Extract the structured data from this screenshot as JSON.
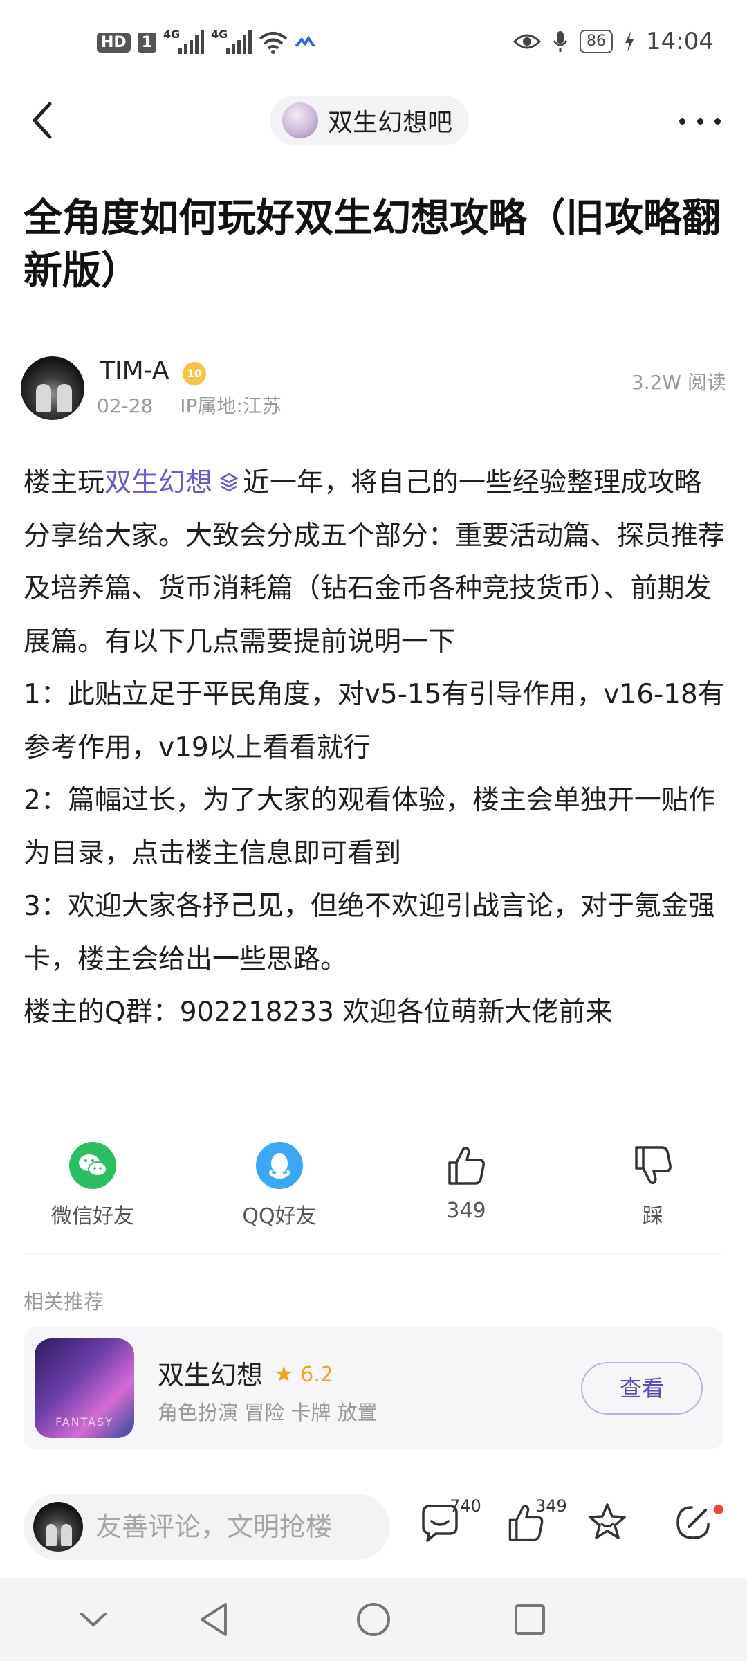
{
  "status_bar": {
    "left_icons": [
      "hd-icon",
      "sim-icon",
      "signal-icon",
      "signal-icon",
      "wifi-icon",
      "app-notification-icon"
    ],
    "network_tag_1": "4G",
    "network_tag_2": "4G",
    "hd_label": "HD",
    "sim_label": "1",
    "battery": "86",
    "time": "14:04"
  },
  "nav": {
    "forum_name": "双生幻想吧"
  },
  "post": {
    "title": "全角度如何玩好双生幻想攻略（旧攻略翻新版）",
    "author": {
      "name": "TIM-A",
      "level": "10",
      "date": "02-28",
      "ip_location": "IP属地:江苏",
      "reads": "3.2W 阅读"
    },
    "body": {
      "p1_prefix": "楼主玩",
      "p1_link": "双生幻想",
      "p1_suffix": "近一年，将自己的一些经验整理成攻略分享给大家。大致会分成五个部分：重要活动篇、探员推荐及培养篇、货币消耗篇（钻石金币各种竞技货币）、前期发展篇。有以下几点需要提前说明一下",
      "p2": "1：此贴立足于平民角度，对v5-15有引导作用，v16-18有参考作用，v19以上看看就行",
      "p3": "2：篇幅过长，为了大家的观看体验，楼主会单独开一贴作为目录，点击楼主信息即可看到",
      "p4": "3：欢迎大家各抒己见，但绝不欢迎引战言论，对于氪金强卡，楼主会给出一些思路。",
      "p5": "楼主的Q群：902218233 欢迎各位萌新大佬前来"
    }
  },
  "share": {
    "wechat": "微信好友",
    "qq": "QQ好友",
    "like_count": "349",
    "dislike": "踩"
  },
  "recommend": {
    "header": "相关推荐",
    "game": {
      "name": "双生幻想",
      "rating": "6.2",
      "tags": "角色扮演 冒险 卡牌 放置",
      "button": "查看"
    }
  },
  "bottom_bar": {
    "placeholder": "友善评论，文明抢楼",
    "comment_count": "740",
    "like_count": "349"
  },
  "colors": {
    "link": "#6b58c9",
    "wechat_green": "#2bbf61",
    "qq_blue": "#3aa8f5",
    "star_orange": "#f1a423",
    "badge_gold": "#f6c344"
  }
}
